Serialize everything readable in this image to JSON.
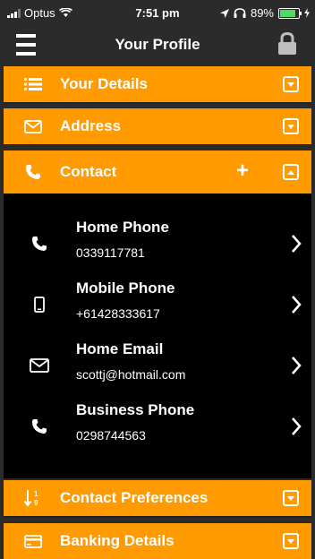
{
  "status_bar": {
    "carrier": "Optus",
    "time": "7:51 pm",
    "battery": "89%",
    "battery_level": 0.89
  },
  "navbar": {
    "title": "Your Profile",
    "menu_icon": "hamburger-menu-icon",
    "lock_icon": "lock-icon"
  },
  "sections": {
    "your_details": {
      "label": "Your Details",
      "icon": "list-icon"
    },
    "address": {
      "label": "Address",
      "icon": "envelope-icon"
    },
    "contact": {
      "label": "Contact",
      "icon": "phone-icon"
    },
    "contact_preferences": {
      "label": "Contact Preferences",
      "icon": "sort-numeric-icon"
    },
    "banking_details": {
      "label": "Banking Details",
      "icon": "credit-card-icon"
    }
  },
  "contacts": [
    {
      "title": "Home Phone",
      "value": "0339117781",
      "icon": "phone-icon"
    },
    {
      "title": "Mobile Phone",
      "value": "+61428333617",
      "icon": "mobile-icon"
    },
    {
      "title": "Home Email",
      "value": "scottj@hotmail.com",
      "icon": "envelope-icon"
    },
    {
      "title": "Business Phone",
      "value": "0298744563",
      "icon": "phone-icon"
    }
  ],
  "colors": {
    "accent": "#ff9a00",
    "panel": "#000000",
    "background": "#2b2b2b"
  }
}
